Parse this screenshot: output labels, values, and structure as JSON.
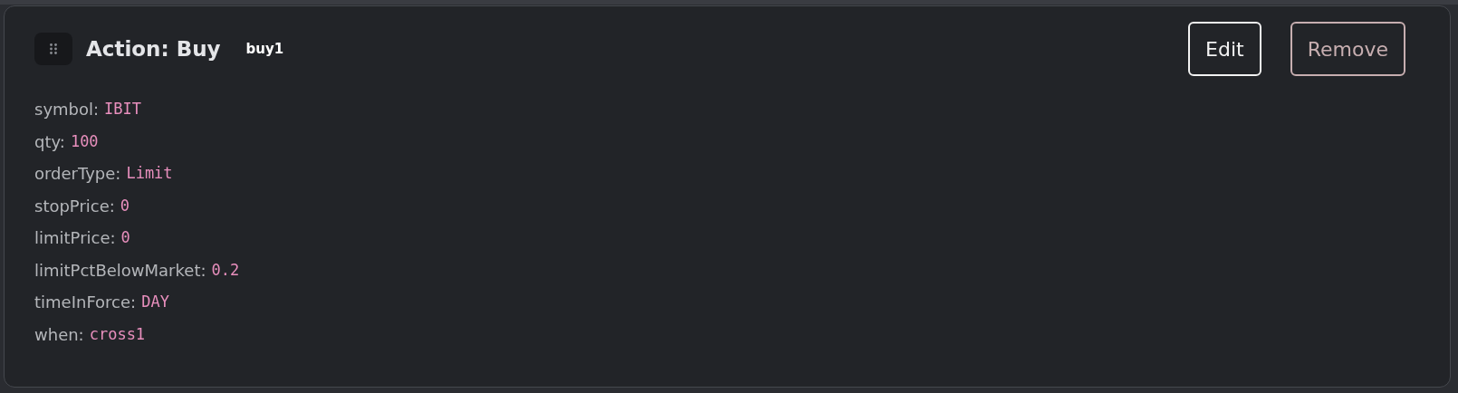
{
  "card": {
    "title": "Action: Buy",
    "id": "buy1",
    "buttons": [
      {
        "label": "Edit",
        "kind": "primary"
      },
      {
        "label": "Remove",
        "kind": "danger"
      }
    ],
    "fields": [
      {
        "key": "symbol:",
        "value": "IBIT"
      },
      {
        "key": "qty:",
        "value": "100"
      },
      {
        "key": "orderType:",
        "value": "Limit"
      },
      {
        "key": "stopPrice:",
        "value": "0"
      },
      {
        "key": "limitPrice:",
        "value": "0"
      },
      {
        "key": "limitPctBelowMarket:",
        "value": "0.2"
      },
      {
        "key": "timeInForce:",
        "value": "DAY"
      },
      {
        "key": "when:",
        "value": "cross1"
      }
    ]
  }
}
